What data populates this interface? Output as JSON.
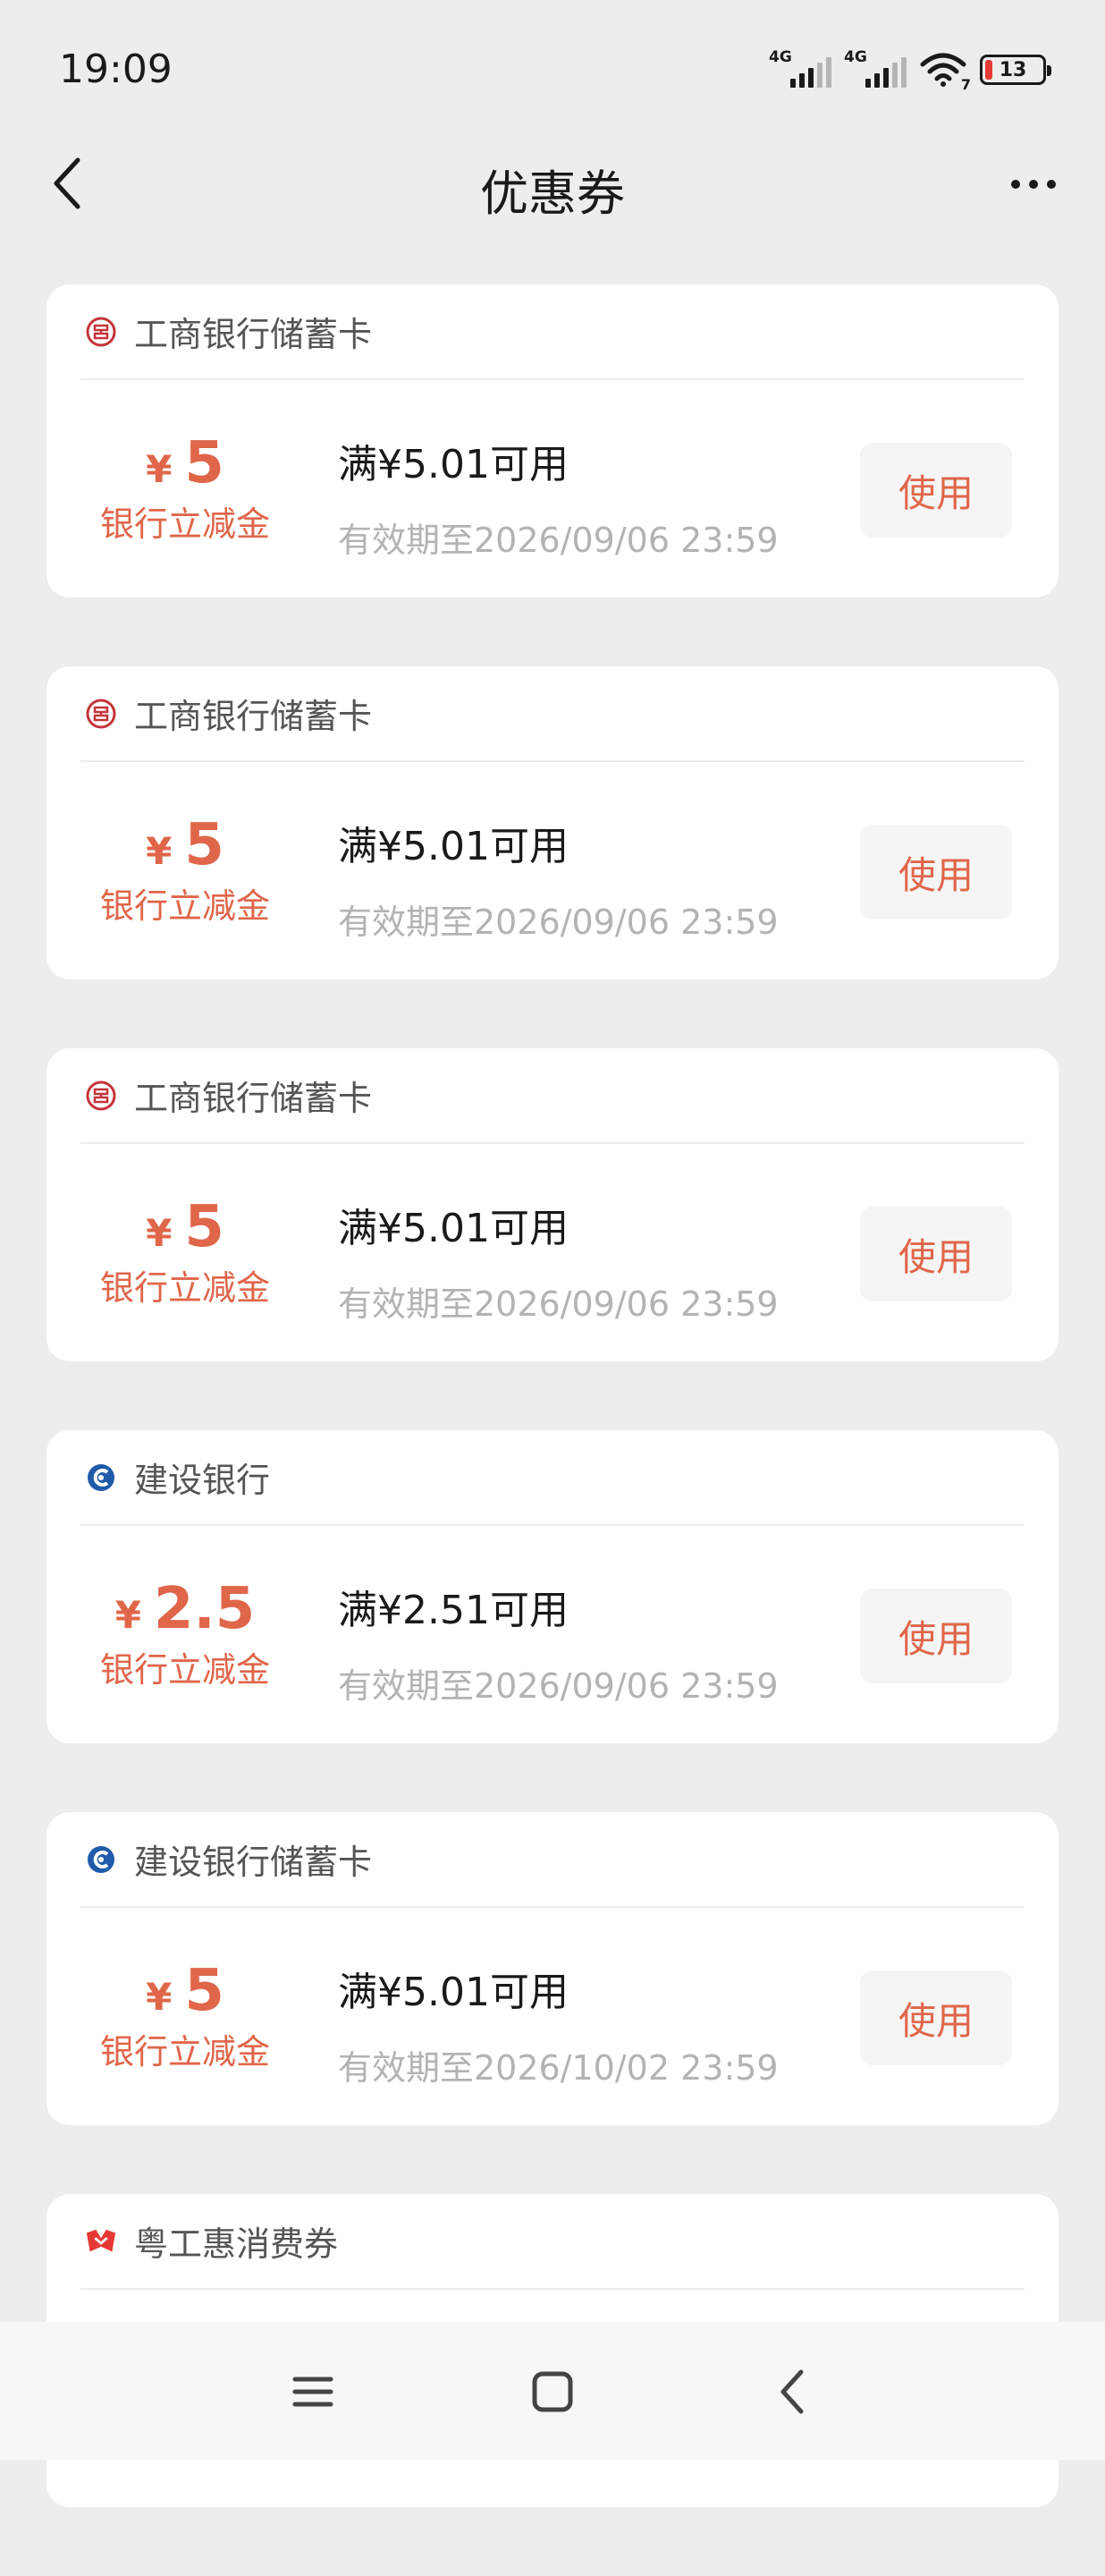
{
  "status_bar": {
    "time": "19:09",
    "network_1": "4G",
    "network_2": "4G",
    "wifi_badge": "7",
    "battery": "13"
  },
  "header": {
    "title": "优惠券"
  },
  "coupons": [
    {
      "bank": "工商银行储蓄卡",
      "logo": "icbc-logo-icon",
      "currency": "¥",
      "amount": "5",
      "amount_label": "银行立减金",
      "condition": "满¥5.01可用",
      "expiry": "有效期至2026/09/06 23:59",
      "button": "使用"
    },
    {
      "bank": "工商银行储蓄卡",
      "logo": "icbc-logo-icon",
      "currency": "¥",
      "amount": "5",
      "amount_label": "银行立减金",
      "condition": "满¥5.01可用",
      "expiry": "有效期至2026/09/06 23:59",
      "button": "使用"
    },
    {
      "bank": "工商银行储蓄卡",
      "logo": "icbc-logo-icon",
      "currency": "¥",
      "amount": "5",
      "amount_label": "银行立减金",
      "condition": "满¥5.01可用",
      "expiry": "有效期至2026/09/06 23:59",
      "button": "使用"
    },
    {
      "bank": "建设银行",
      "logo": "ccb-logo-icon",
      "currency": "¥",
      "amount": "2.5",
      "amount_label": "银行立减金",
      "condition": "满¥2.51可用",
      "expiry": "有效期至2026/09/06 23:59",
      "button": "使用"
    },
    {
      "bank": "建设银行储蓄卡",
      "logo": "ccb-logo-icon",
      "currency": "¥",
      "amount": "5",
      "amount_label": "银行立减金",
      "condition": "满¥5.01可用",
      "expiry": "有效期至2026/10/02 23:59",
      "button": "使用"
    },
    {
      "bank": "粤工惠消费券",
      "logo": "yuegonghui-logo-icon"
    }
  ],
  "colors": {
    "accent": "#e0664a",
    "background": "#ededed",
    "card": "#ffffff",
    "muted_text": "#b3b3b3"
  }
}
